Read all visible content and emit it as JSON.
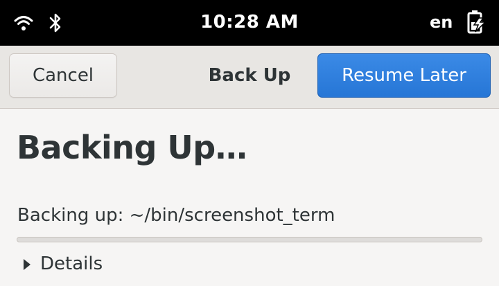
{
  "status_bar": {
    "clock": "10:28 AM",
    "language": "en",
    "icons": [
      "wifi-icon",
      "bluetooth-icon",
      "battery-charging-icon"
    ]
  },
  "header": {
    "cancel_label": "Cancel",
    "title": "Back Up",
    "resume_label": "Resume Later"
  },
  "content": {
    "heading": "Backing Up…",
    "status": "Backing up: ~/bin/screenshot_term",
    "progress_fraction": 0,
    "details_label": "Details"
  },
  "colors": {
    "accent": "#3584e4",
    "topbar_bg": "#000000",
    "window_bg": "#f6f5f4"
  }
}
